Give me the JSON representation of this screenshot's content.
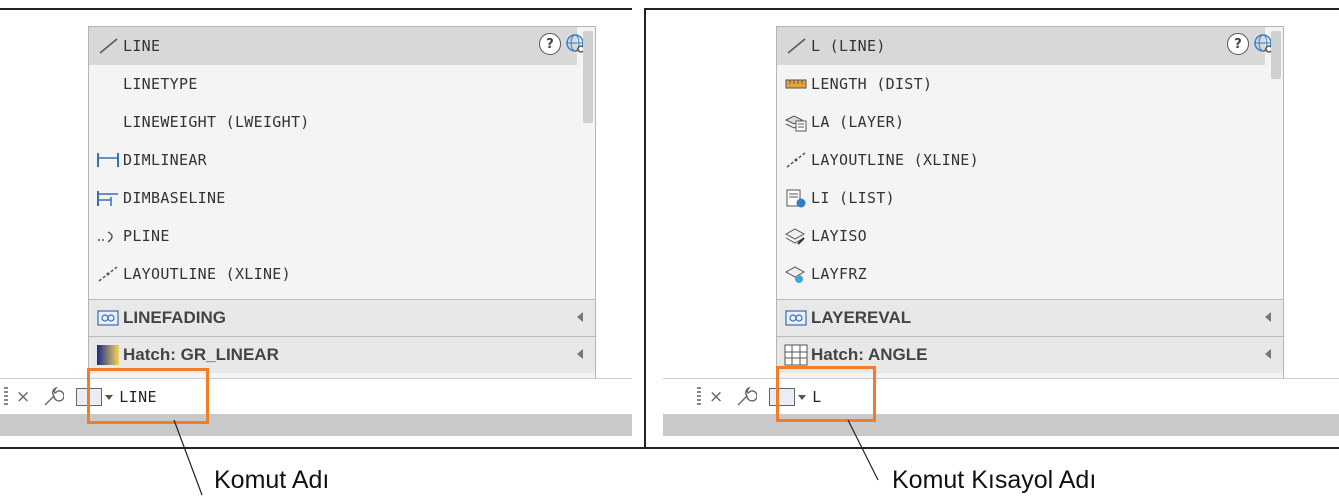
{
  "left": {
    "items": [
      {
        "label": "LINE",
        "icon": "line-icon",
        "selected": true
      },
      {
        "label": "LINETYPE",
        "icon": ""
      },
      {
        "label": "LINEWEIGHT (LWEIGHT)",
        "icon": ""
      },
      {
        "label": "DIMLINEAR",
        "icon": "dimlinear-icon"
      },
      {
        "label": "DIMBASELINE",
        "icon": "dimbaseline-icon"
      },
      {
        "label": "PLINE",
        "icon": "pline-icon"
      },
      {
        "label": "LAYOUTLINE (XLINE)",
        "icon": "xline-icon"
      }
    ],
    "groups": [
      {
        "label": "LINEFADING",
        "icon": "system-variable-icon"
      },
      {
        "label": "Hatch: GR_LINEAR",
        "icon": "gradient-icon"
      }
    ],
    "command_input": "LINE",
    "callout": "Komut Adı"
  },
  "right": {
    "items": [
      {
        "label": "L (LINE)",
        "icon": "line-icon",
        "selected": true
      },
      {
        "label": "LENGTH (DIST)",
        "icon": "measure-icon"
      },
      {
        "label": "LA (LAYER)",
        "icon": "layer-icon"
      },
      {
        "label": "LAYOUTLINE (XLINE)",
        "icon": "xline-icon"
      },
      {
        "label": "LI (LIST)",
        "icon": "list-icon"
      },
      {
        "label": "LAYISO",
        "icon": "layiso-icon"
      },
      {
        "label": "LAYFRZ",
        "icon": "layfrz-icon"
      }
    ],
    "groups": [
      {
        "label": "LAYEREVAL",
        "icon": "system-variable-icon"
      },
      {
        "label": "Hatch: ANGLE",
        "icon": "hatch-icon"
      }
    ],
    "command_input": "L",
    "callout": "Komut Kısayol Adı"
  },
  "help_symbol": "?",
  "close_symbol": "×",
  "colors": {
    "highlight": "#f07d2a",
    "selected_row": "#d8d8d8",
    "panel_bg": "#f4f4f4"
  }
}
